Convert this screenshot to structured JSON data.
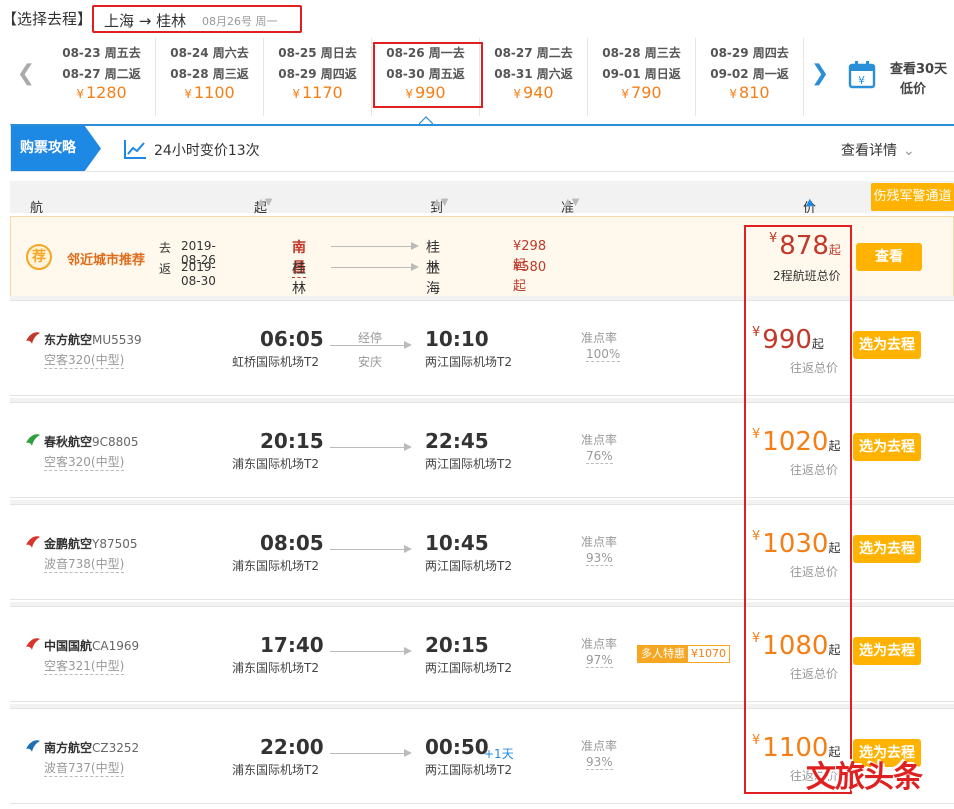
{
  "header": {
    "label": "【选择去程】",
    "route": "上海 → 桂林",
    "date": "08月26号 周一"
  },
  "dates": [
    {
      "go": "08-23 周五去",
      "ret": "08-27 周二返",
      "price": "1280"
    },
    {
      "go": "08-24 周六去",
      "ret": "08-28 周三返",
      "price": "1100"
    },
    {
      "go": "08-25 周日去",
      "ret": "08-29 周四返",
      "price": "1170"
    },
    {
      "go": "08-26 周一去",
      "ret": "08-30 周五返",
      "price": "990"
    },
    {
      "go": "08-27 周二去",
      "ret": "08-31 周六返",
      "price": "940"
    },
    {
      "go": "08-28 周三去",
      "ret": "09-01 周日返",
      "price": "790"
    },
    {
      "go": "08-29 周四去",
      "ret": "09-02 周一返",
      "price": "810"
    }
  ],
  "currency": "¥",
  "cal30": {
    "line1": "查看30天",
    "line2": "低价"
  },
  "guide": {
    "tab": "购票攻略",
    "trend": "24小时变价13次",
    "detail": "查看详情"
  },
  "thead": {
    "info": "航班信息",
    "dep": "起飞时间",
    "arr": "到达时间",
    "ontime": "准点率",
    "price": "价格",
    "military": "伤残军警通道"
  },
  "recommend": {
    "badge": "荐",
    "title": "邻近城市推荐",
    "go_key": "去",
    "go_date": "2019-08-26",
    "go_from": "南昌",
    "go_to": "桂林",
    "go_price": "¥298起",
    "ret_key": "返",
    "ret_date": "2019-08-30",
    "ret_from": "桂林",
    "ret_to": "上海",
    "ret_price": "¥580起",
    "price": "878",
    "price_suffix": "起",
    "note": "2程航班总价",
    "button": "查看"
  },
  "flights": [
    {
      "airline": "东方航空",
      "code": "MU5539",
      "plane": "空客320(中型)",
      "dep": "06:05",
      "dep_ap": "虹桥国际机场T2",
      "stop_label": "经停",
      "stop_city": "安庆",
      "arr": "10:10",
      "arr_ap": "两江国际机场T2",
      "plus_day": "",
      "ontime_label": "准点率",
      "ontime": "100%",
      "promo_label": "",
      "promo_price": "",
      "price": "990",
      "price_suffix": "起",
      "note": "往返总价",
      "button": "选为去程",
      "color": "#c0392b"
    },
    {
      "airline": "春秋航空",
      "code": "9C8805",
      "plane": "空客320(中型)",
      "dep": "20:15",
      "dep_ap": "浦东国际机场T2",
      "stop_label": "",
      "stop_city": "",
      "arr": "22:45",
      "arr_ap": "两江国际机场T2",
      "plus_day": "",
      "ontime_label": "准点率",
      "ontime": "76%",
      "promo_label": "",
      "promo_price": "",
      "price": "1020",
      "price_suffix": "起",
      "note": "往返总价",
      "button": "选为去程",
      "color": "#2e9e3e"
    },
    {
      "airline": "金鹏航空",
      "code": "Y87505",
      "plane": "波音738(中型)",
      "dep": "08:05",
      "dep_ap": "浦东国际机场T2",
      "stop_label": "",
      "stop_city": "",
      "arr": "10:45",
      "arr_ap": "两江国际机场T2",
      "plus_day": "",
      "ontime_label": "准点率",
      "ontime": "93%",
      "promo_label": "",
      "promo_price": "",
      "price": "1030",
      "price_suffix": "起",
      "note": "往返总价",
      "button": "选为去程",
      "color": "#d9342b"
    },
    {
      "airline": "中国国航",
      "code": "CA1969",
      "plane": "空客321(中型)",
      "dep": "17:40",
      "dep_ap": "浦东国际机场T2",
      "stop_label": "",
      "stop_city": "",
      "arr": "20:15",
      "arr_ap": "两江国际机场T2",
      "plus_day": "",
      "ontime_label": "准点率",
      "ontime": "97%",
      "promo_label": "多人特惠",
      "promo_price": "¥1070",
      "price": "1080",
      "price_suffix": "起",
      "note": "往返总价",
      "button": "选为去程",
      "color": "#d9342b"
    },
    {
      "airline": "南方航空",
      "code": "CZ3252",
      "plane": "波音737(中型)",
      "dep": "22:00",
      "dep_ap": "浦东国际机场T2",
      "stop_label": "",
      "stop_city": "",
      "arr": "00:50",
      "arr_ap": "两江国际机场T2",
      "plus_day": "+1天",
      "ontime_label": "准点率",
      "ontime": "93%",
      "promo_label": "",
      "promo_price": "",
      "price": "1100",
      "price_suffix": "起",
      "note": "往返总价",
      "button": "选为去程",
      "color": "#1f6fb5"
    }
  ],
  "watermark": "文旅头条"
}
